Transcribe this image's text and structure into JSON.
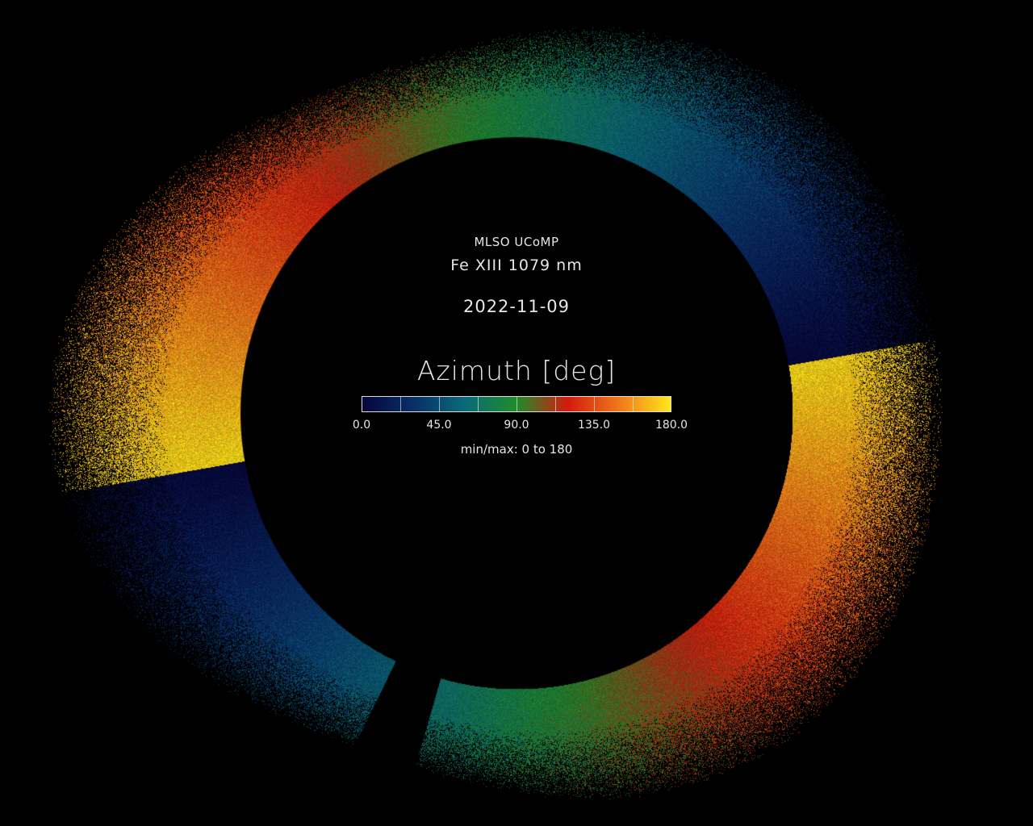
{
  "observatory": "MLSO UCoMP",
  "line_name": "Fe XIII 1079 nm",
  "obs_date": "2022-11-09",
  "quantity_label": "Azimuth [deg]",
  "colorbar": {
    "ticks": [
      "0.0",
      "45.0",
      "90.0",
      "135.0",
      "180.0"
    ],
    "range_text": "min/max: 0 to 180",
    "colors": [
      "#06063a",
      "#0a2f6a",
      "#0a6a78",
      "#1f8c2a",
      "#d61a0e",
      "#f0781a",
      "#ffe81a"
    ]
  }
}
